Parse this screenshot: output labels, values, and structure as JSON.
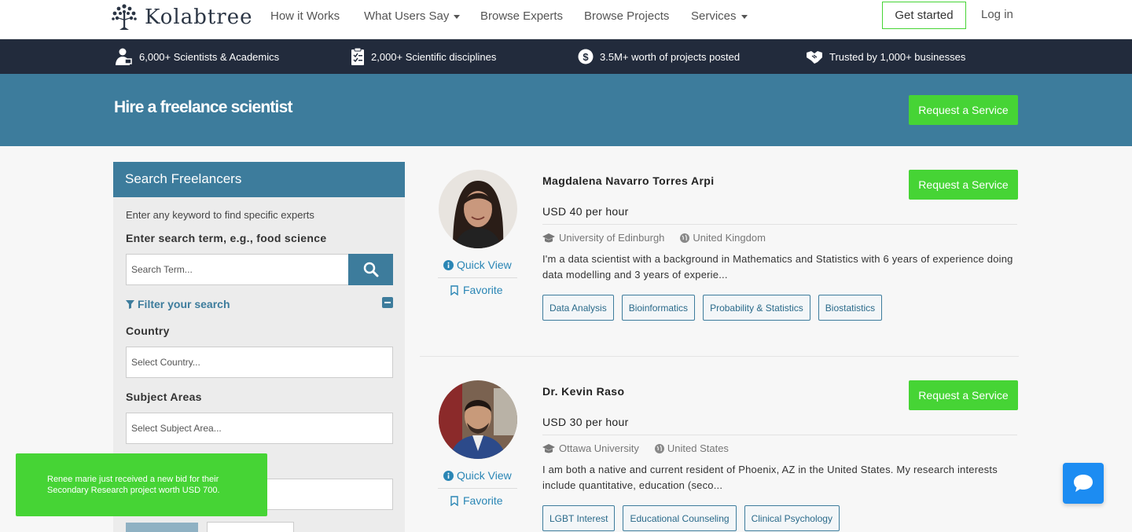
{
  "nav": {
    "logo_text": "Kolabtree",
    "links": [
      "How it Works",
      "What Users Say",
      "Browse Experts",
      "Browse Projects",
      "Services"
    ],
    "get_started": "Get started",
    "login": "Log in"
  },
  "stats": [
    {
      "icon": "scientist-icon",
      "text": "6,000+ Scientists & Academics"
    },
    {
      "icon": "clipboard-icon",
      "text": "2,000+ Scientific disciplines"
    },
    {
      "icon": "dollar-icon",
      "text": "3.5M+ worth of projects posted"
    },
    {
      "icon": "handshake-icon",
      "text": "Trusted by 1,000+ businesses"
    }
  ],
  "hero": {
    "title": "Hire a freelance scientist",
    "button": "Request a Service"
  },
  "sidebar": {
    "title": "Search Freelancers",
    "hint": "Enter any keyword to find specific experts",
    "search_label": "Enter search term, e.g., food science",
    "search_placeholder": "Search Term...",
    "filter_label": "Filter your search",
    "country_label": "Country",
    "country_placeholder": "Select Country...",
    "subject_label": "Subject Areas",
    "subject_placeholder": "Select Subject Area..."
  },
  "experts": [
    {
      "name": "Magdalena Navarro Torres Arpi",
      "rate": "USD 40 per hour",
      "university": "University of Edinburgh",
      "country": "United Kingdom",
      "bio": "I'm a data scientist with a background in Mathematics and Statistics with 6 years of experience doing data modelling and 3 years of experie...",
      "tags": [
        "Data Analysis",
        "Bioinformatics",
        "Probability & Statistics",
        "Biostatistics"
      ],
      "quick_view": "Quick View",
      "favorite": "Favorite",
      "button": "Request a Service"
    },
    {
      "name": "Dr. Kevin Raso",
      "rate": "USD 30 per hour",
      "university": "Ottawa University",
      "country": "United States",
      "bio": "I am both a native and current resident of Phoenix, AZ in the United States. My research interests include quantitative, education (seco...",
      "tags": [
        "LGBT Interest",
        "Educational Counseling",
        "Clinical Psychology"
      ],
      "quick_view": "Quick View",
      "favorite": "Favorite",
      "button": "Request a Service"
    }
  ],
  "toast": {
    "message": "Renee marie just received a new bid for their Secondary Research project worth USD 700."
  },
  "colors": {
    "brand_blue": "#3d7c9c",
    "dark_bar": "#222b3c",
    "accent_green": "#46d435",
    "link_blue": "#2a86b5",
    "chat_blue": "#1c8cf2"
  }
}
